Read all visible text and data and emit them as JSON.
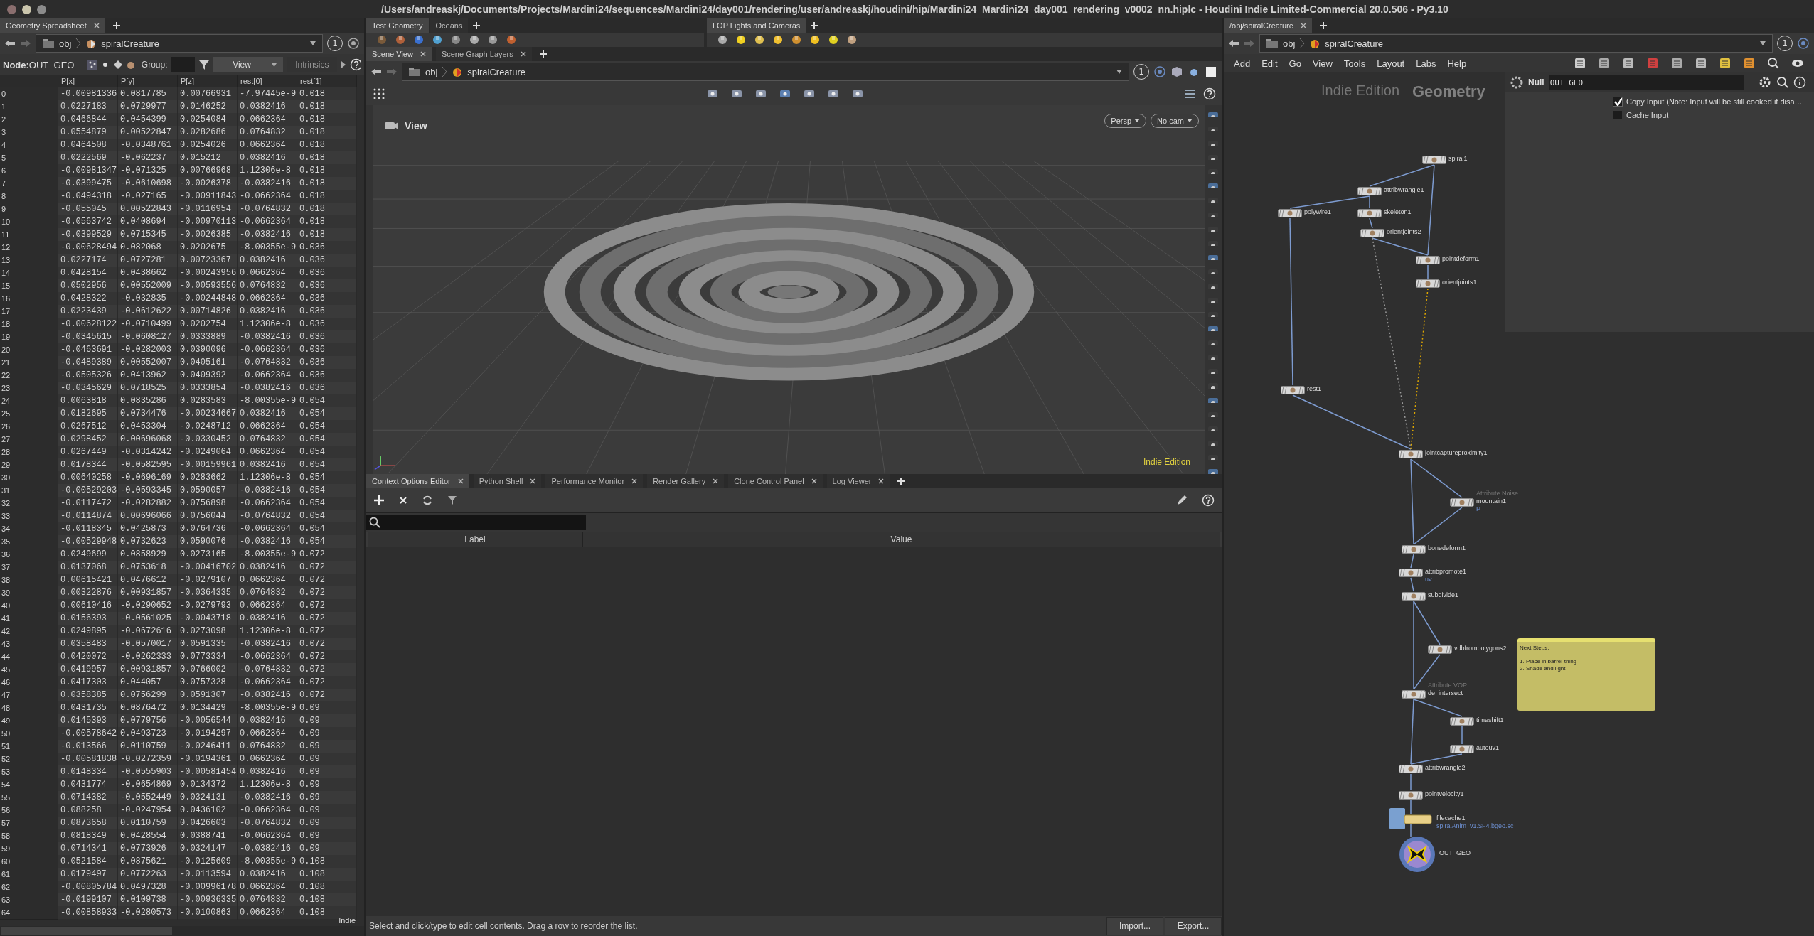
{
  "window": {
    "title": "/Users/andreaskj/Documents/Projects/Mardini24/sequences/Mardini24/day001/rendering/user/andreaskj/houdini/hip/Mardini24_Mardini24_day001_rendering_v0002_nn.hiplc - Houdini Indie Limited-Commercial 20.0.506 - Py3.10"
  },
  "spreadsheet": {
    "tab": {
      "label": "Geometry Spreadsheet",
      "selected": true
    },
    "path": [
      "obj",
      "spiralCreature"
    ],
    "path_badge": "1",
    "node_label": "Node:",
    "node_name": "OUT_GEO",
    "group_label": "Group:",
    "view_menu": "View",
    "intrinsics": "Intrinsics",
    "columns": [
      "",
      "P[x]",
      "P[y]",
      "P[z]",
      "rest[0]",
      "rest[1]"
    ],
    "rows": [
      [
        "0",
        "-0.00981336",
        "0.0817785",
        "0.00766931",
        "-7.97445e-9",
        "0.018"
      ],
      [
        "1",
        "0.0227183",
        "0.0729977",
        "0.0146252",
        "0.0382416",
        "0.018"
      ],
      [
        "2",
        "0.0466844",
        "0.0454399",
        "0.0254084",
        "0.0662364",
        "0.018"
      ],
      [
        "3",
        "0.0554879",
        "0.00522847",
        "0.0282686",
        "0.0764832",
        "0.018"
      ],
      [
        "4",
        "0.0464508",
        "-0.0348761",
        "0.0254026",
        "0.0662364",
        "0.018"
      ],
      [
        "5",
        "0.0222569",
        "-0.062237",
        "0.015212",
        "0.0382416",
        "0.018"
      ],
      [
        "6",
        "-0.00981347",
        "-0.071325",
        "0.00766968",
        "1.12306e-8",
        "0.018"
      ],
      [
        "7",
        "-0.0399475",
        "-0.0610698",
        "-0.0026378",
        "-0.0382416",
        "0.018"
      ],
      [
        "8",
        "-0.0494318",
        "-0.027165",
        "-0.00911843",
        "-0.0662364",
        "0.018"
      ],
      [
        "9",
        "-0.055045",
        "0.00522843",
        "-0.0116954",
        "-0.0764832",
        "0.018"
      ],
      [
        "10",
        "-0.0563742",
        "0.0408694",
        "-0.00970113",
        "-0.0662364",
        "0.018"
      ],
      [
        "11",
        "-0.0399529",
        "0.0715345",
        "-0.0026385",
        "-0.0382416",
        "0.018"
      ],
      [
        "12",
        "-0.00628494",
        "0.082068",
        "0.0202675",
        "-8.00355e-9",
        "0.036"
      ],
      [
        "13",
        "0.0227174",
        "0.0727281",
        "0.00723367",
        "0.0382416",
        "0.036"
      ],
      [
        "14",
        "0.0428154",
        "0.0438662",
        "-0.00243956",
        "0.0662364",
        "0.036"
      ],
      [
        "15",
        "0.0502956",
        "0.00552009",
        "-0.00593556",
        "0.0764832",
        "0.036"
      ],
      [
        "16",
        "0.0428322",
        "-0.032835",
        "-0.00244848",
        "0.0662364",
        "0.036"
      ],
      [
        "17",
        "0.0223439",
        "-0.0612622",
        "0.00714826",
        "0.0382416",
        "0.036"
      ],
      [
        "18",
        "-0.00628122",
        "-0.0710499",
        "0.0202754",
        "1.12306e-8",
        "0.036"
      ],
      [
        "19",
        "-0.0345615",
        "-0.0608127",
        "0.0333889",
        "-0.0382416",
        "0.036"
      ],
      [
        "20",
        "-0.0463691",
        "-0.0282003",
        "0.0390096",
        "-0.0662364",
        "0.036"
      ],
      [
        "21",
        "-0.0489389",
        "0.00552007",
        "0.0405161",
        "-0.0764832",
        "0.036"
      ],
      [
        "22",
        "-0.0505326",
        "0.0413962",
        "0.0409392",
        "-0.0662364",
        "0.036"
      ],
      [
        "23",
        "-0.0345629",
        "0.0718525",
        "0.0333854",
        "-0.0382416",
        "0.036"
      ],
      [
        "24",
        "0.0063818",
        "0.0835286",
        "0.0283583",
        "-8.00355e-9",
        "0.054"
      ],
      [
        "25",
        "0.0182695",
        "0.0734476",
        "-0.00234667",
        "0.0382416",
        "0.054"
      ],
      [
        "26",
        "0.0267512",
        "0.0453304",
        "-0.0248712",
        "0.0662364",
        "0.054"
      ],
      [
        "27",
        "0.0298452",
        "0.00696068",
        "-0.0330452",
        "0.0764832",
        "0.054"
      ],
      [
        "28",
        "0.0267449",
        "-0.0314242",
        "-0.0249064",
        "0.0662364",
        "0.054"
      ],
      [
        "29",
        "0.0178344",
        "-0.0582595",
        "-0.00159961",
        "0.0382416",
        "0.054"
      ],
      [
        "30",
        "0.00640258",
        "-0.0696169",
        "0.0283662",
        "1.12306e-8",
        "0.054"
      ],
      [
        "31",
        "-0.00529203",
        "-0.0593345",
        "0.0590057",
        "-0.0382416",
        "0.054"
      ],
      [
        "32",
        "-0.0117472",
        "-0.0282882",
        "0.0756898",
        "-0.0662364",
        "0.054"
      ],
      [
        "33",
        "-0.0114874",
        "0.00696066",
        "0.0756044",
        "-0.0764832",
        "0.054"
      ],
      [
        "34",
        "-0.0118345",
        "0.0425873",
        "0.0764736",
        "-0.0662364",
        "0.054"
      ],
      [
        "35",
        "-0.00529948",
        "0.0732623",
        "0.0590076",
        "-0.0382416",
        "0.054"
      ],
      [
        "36",
        "0.0249699",
        "0.0858929",
        "0.0273165",
        "-8.00355e-9",
        "0.072"
      ],
      [
        "37",
        "0.0137068",
        "0.0753618",
        "-0.00416702",
        "0.0382416",
        "0.072"
      ],
      [
        "38",
        "0.00615421",
        "0.0476612",
        "-0.0279107",
        "0.0662364",
        "0.072"
      ],
      [
        "39",
        "0.00322876",
        "0.00931857",
        "-0.0364335",
        "0.0764832",
        "0.072"
      ],
      [
        "40",
        "0.00610416",
        "-0.0290652",
        "-0.0279793",
        "0.0662364",
        "0.072"
      ],
      [
        "41",
        "0.0156393",
        "-0.0561025",
        "-0.0043718",
        "0.0382416",
        "0.072"
      ],
      [
        "42",
        "0.0249895",
        "-0.0672616",
        "0.0273098",
        "1.12306e-8",
        "0.072"
      ],
      [
        "43",
        "0.0358483",
        "-0.0570017",
        "0.0591335",
        "-0.0382416",
        "0.072"
      ],
      [
        "44",
        "0.0420072",
        "-0.0262333",
        "0.0773334",
        "-0.0662364",
        "0.072"
      ],
      [
        "45",
        "0.0419957",
        "0.00931857",
        "0.0766002",
        "-0.0764832",
        "0.072"
      ],
      [
        "46",
        "0.0417303",
        "0.044057",
        "0.0757328",
        "-0.0662364",
        "0.072"
      ],
      [
        "47",
        "0.0358385",
        "0.0756299",
        "0.0591307",
        "-0.0382416",
        "0.072"
      ],
      [
        "48",
        "0.0431735",
        "0.0876472",
        "0.0134429",
        "-8.00355e-9",
        "0.09"
      ],
      [
        "49",
        "0.0145393",
        "0.0779756",
        "-0.0056544",
        "0.0382416",
        "0.09"
      ],
      [
        "50",
        "-0.00578642",
        "0.0493723",
        "-0.0194297",
        "0.0662364",
        "0.09"
      ],
      [
        "51",
        "-0.013566",
        "0.0110759",
        "-0.0246411",
        "0.0764832",
        "0.09"
      ],
      [
        "52",
        "-0.00581838",
        "-0.0272359",
        "-0.0194361",
        "0.0662364",
        "0.09"
      ],
      [
        "53",
        "0.0148334",
        "-0.0555903",
        "-0.00581454",
        "0.0382416",
        "0.09"
      ],
      [
        "54",
        "0.0431774",
        "-0.0654869",
        "0.0134372",
        "1.12306e-8",
        "0.09"
      ],
      [
        "55",
        "0.0714382",
        "-0.0552449",
        "0.0324131",
        "-0.0382416",
        "0.09"
      ],
      [
        "56",
        "0.088258",
        "-0.0247954",
        "0.0436102",
        "-0.0662364",
        "0.09"
      ],
      [
        "57",
        "0.0873658",
        "0.0110759",
        "0.0426603",
        "-0.0764832",
        "0.09"
      ],
      [
        "58",
        "0.0818349",
        "0.0428554",
        "0.0388741",
        "-0.0662364",
        "0.09"
      ],
      [
        "59",
        "0.0714341",
        "0.0773926",
        "0.0324147",
        "-0.0382416",
        "0.09"
      ],
      [
        "60",
        "0.0521584",
        "0.0875621",
        "-0.0125609",
        "-8.00355e-9",
        "0.108"
      ],
      [
        "61",
        "0.0179497",
        "0.0772263",
        "-0.0113594",
        "0.0382416",
        "0.108"
      ],
      [
        "62",
        "-0.00805784",
        "0.0497328",
        "-0.00996178",
        "0.0662364",
        "0.108"
      ],
      [
        "63",
        "-0.0199107",
        "0.0109738",
        "-0.00936335",
        "0.0764832",
        "0.108"
      ],
      [
        "64",
        "-0.00858933",
        "-0.0280573",
        "-0.0100863",
        "0.0662364",
        "0.108"
      ]
    ],
    "edition": "Indie"
  },
  "shelves": [
    {
      "tabs": [
        {
          "label": "Test Geometry",
          "selected": true
        },
        {
          "label": "Oceans",
          "selected": false
        }
      ]
    },
    {
      "tabs": [
        {
          "label": "LOP Lights and Cameras",
          "selected": true
        }
      ]
    }
  ],
  "scene_view": {
    "tabs": [
      {
        "label": "Scene View",
        "selected": true
      },
      {
        "label": "Scene Graph Layers",
        "selected": false
      }
    ],
    "path": [
      "obj",
      "spiralCreature"
    ],
    "path_badge": "1",
    "viewport_label": "View",
    "camera_buttons": [
      "Persp",
      "No cam"
    ],
    "edition": "Indie Edition"
  },
  "context_options": {
    "tabs": [
      {
        "label": "Context Options Editor",
        "selected": true
      },
      {
        "label": "Python Shell",
        "selected": false
      },
      {
        "label": "Performance Monitor",
        "selected": false
      },
      {
        "label": "Render Gallery",
        "selected": false
      },
      {
        "label": "Clone Control Panel",
        "selected": false
      },
      {
        "label": "Log Viewer",
        "selected": false
      }
    ],
    "columns": [
      "Label",
      "Value"
    ],
    "status": "Select and click/type to edit cell contents. Drag a row to reorder the list.",
    "buttons": [
      "Import...",
      "Export..."
    ]
  },
  "network": {
    "tab": {
      "label": "/obj/spiralCreature",
      "selected": true
    },
    "path": [
      "obj",
      "spiralCreature"
    ],
    "path_badge": "1",
    "menu": [
      "Add",
      "Edit",
      "Go",
      "View",
      "Tools",
      "Layout",
      "Labs",
      "Help"
    ],
    "edition": "Indie Edition",
    "context_label": "Geometry",
    "parameters": {
      "type": "Null",
      "name": "OUT_GEO",
      "toggles": [
        {
          "label": "Copy Input (Note: Input will be still cooked if disa…",
          "checked": true
        },
        {
          "label": "Cache Input",
          "checked": false
        }
      ]
    },
    "nodes": [
      {
        "name": "spiral1",
        "kind": "sop"
      },
      {
        "name": "attribwrangle1",
        "kind": "sop"
      },
      {
        "name": "polywire1",
        "kind": "sop"
      },
      {
        "name": "skeleton1",
        "kind": "sop"
      },
      {
        "name": "orientjoints2",
        "kind": "sop"
      },
      {
        "name": "pointdeform1",
        "kind": "sop"
      },
      {
        "name": "orientjoints1",
        "kind": "sop"
      },
      {
        "name": "rest1",
        "kind": "sop"
      },
      {
        "name": "jointcaptureproximity1",
        "kind": "sop"
      },
      {
        "name": "mountain1",
        "subtitle": "Attribute Noise",
        "tag": "P",
        "kind": "sop"
      },
      {
        "name": "bonedeform1",
        "kind": "sop"
      },
      {
        "name": "attribpromote1",
        "tag": "uv",
        "kind": "sop"
      },
      {
        "name": "subdivide1",
        "kind": "sop"
      },
      {
        "name": "vdbfrompolygons2",
        "kind": "sop"
      },
      {
        "name": "de_intersect",
        "subtitle": "Attribute VOP",
        "kind": "sop"
      },
      {
        "name": "timeshift1",
        "kind": "sop"
      },
      {
        "name": "autouv1",
        "kind": "sop"
      },
      {
        "name": "attribwrangle2",
        "kind": "sop"
      },
      {
        "name": "pointvelocity1",
        "kind": "sop"
      },
      {
        "name": "filecache1",
        "tag": "spiralAnim_v1.$F4.bgeo.sc",
        "kind": "cache"
      },
      {
        "name": "OUT_GEO",
        "kind": "output"
      }
    ],
    "sticky_note": {
      "title": "Next Steps:",
      "lines": [
        "1. Place in barrel-thing",
        "2. Shade and light"
      ]
    }
  }
}
